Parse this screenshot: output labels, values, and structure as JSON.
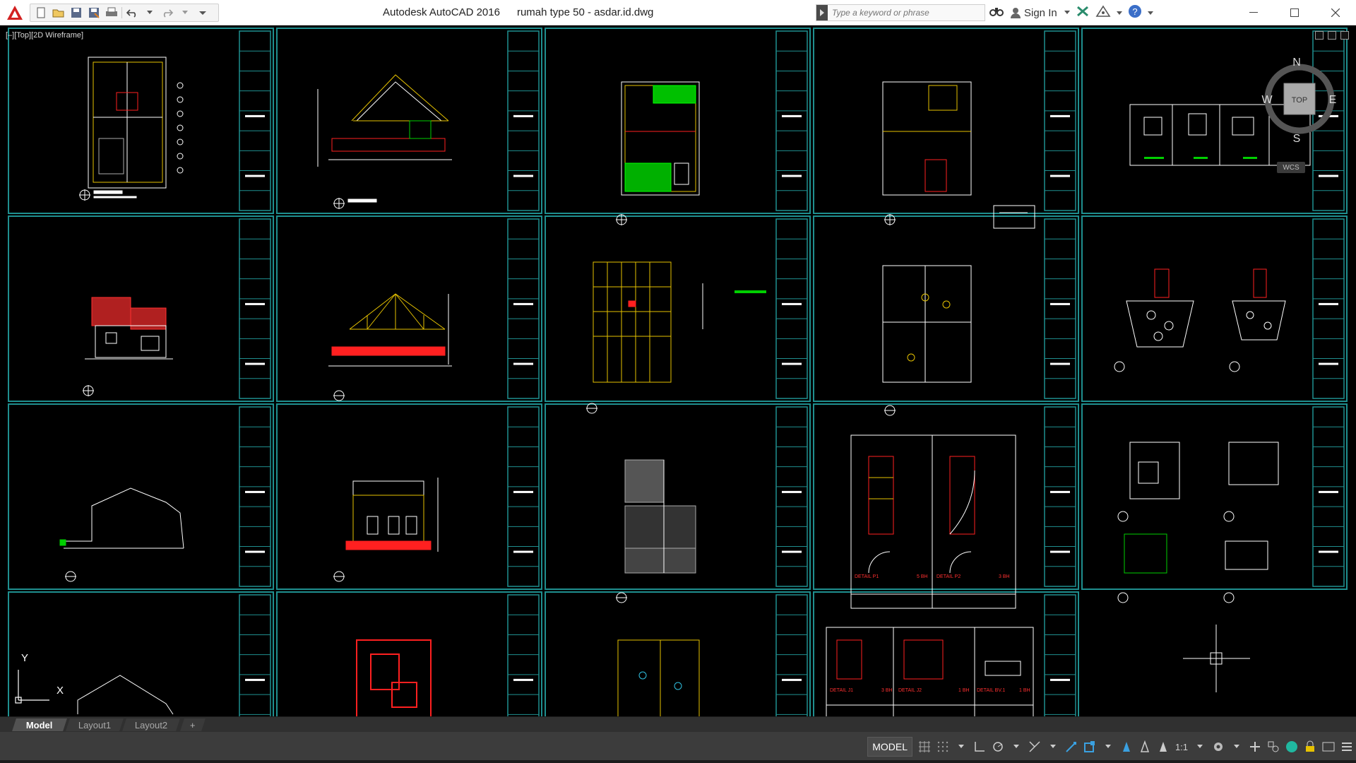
{
  "app": {
    "name": "Autodesk AutoCAD 2016",
    "document": "rumah type 50 - asdar.id.dwg"
  },
  "search": {
    "placeholder": "Type a keyword or phrase"
  },
  "account": {
    "sign_in": "Sign In"
  },
  "viewport": {
    "label": "[–][Top][2D Wireframe]"
  },
  "viewcube": {
    "face": "TOP",
    "north": "N",
    "south": "S",
    "east": "E",
    "west": "W",
    "ucs": "WCS"
  },
  "ucs_icon": {
    "x": "X",
    "y": "Y"
  },
  "tabs": {
    "model": "Model",
    "layout1": "Layout1",
    "layout2": "Layout2",
    "add": "+"
  },
  "status": {
    "model": "MODEL",
    "scale": "1:1"
  },
  "drawing_notes": {
    "detail_p1": "DETAIL P1",
    "detail_p2": "DETAIL P2",
    "detail_j1": "DETAIL J1",
    "detail_j2": "DETAIL J2",
    "detail_bv1": "DETAIL BV.1",
    "qty_p1": "5 BH",
    "qty_p2": "3 BH",
    "qty_j1": "3 BH",
    "qty_j2": "1 BH",
    "qty_bv1": "1 BH"
  },
  "colors": {
    "frame": "#1f8f8f",
    "line": "#ffffff",
    "accent_red": "#ff2020",
    "accent_yellow": "#e6c200",
    "accent_green": "#00d000",
    "background": "#000000"
  }
}
